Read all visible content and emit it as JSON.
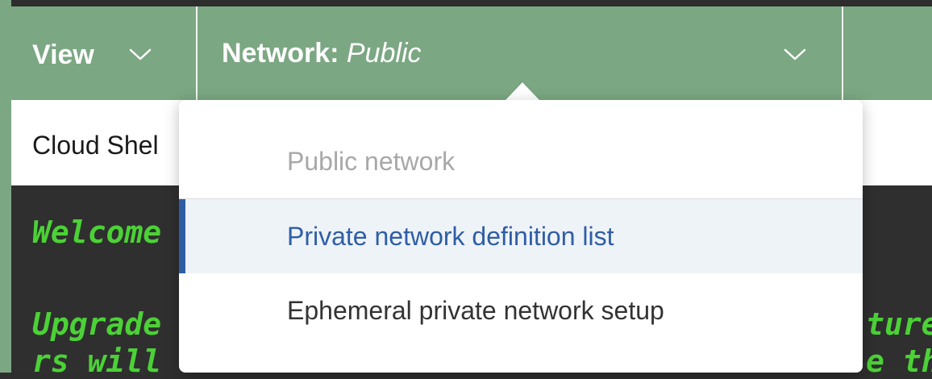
{
  "toolbar": {
    "view_label": "View",
    "network_key": "Network:",
    "network_value": "Public"
  },
  "shell": {
    "title": "Cloud Shel"
  },
  "terminal": {
    "lines": [
      "Welcome",
      "Upgrade",
      "rs will",
      "ture",
      "e th"
    ]
  },
  "network_menu": {
    "items": [
      {
        "label": "Public network",
        "state": "disabled"
      },
      {
        "label": "Private network definition list",
        "state": "selected"
      },
      {
        "label": "Ephemeral private network setup",
        "state": "normal"
      }
    ]
  },
  "colors": {
    "toolbar_green": "#7ba783",
    "terminal_text": "#4cd137",
    "accent_blue": "#2f5ea5"
  },
  "icons": {
    "view_chevron": "chevron-down-icon",
    "network_chevron": "chevron-down-icon"
  }
}
